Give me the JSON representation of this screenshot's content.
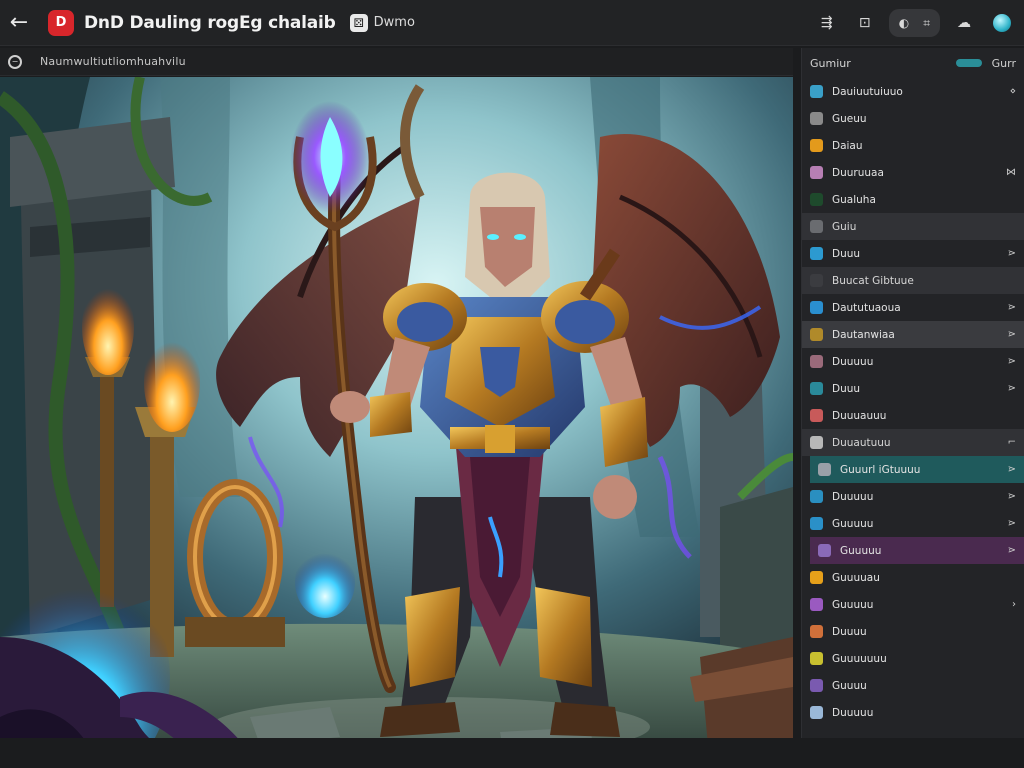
{
  "header": {
    "app_logo": "D",
    "title": "DnD Dauling rogEg chalaib",
    "doc_label": "Dwmo",
    "actions": {
      "share_icon": "share-icon",
      "camera_icon": "camera-icon",
      "pill_left": "◐",
      "pill_right": "⌗"
    }
  },
  "subbar": {
    "path": "Naumwultiutliomhuahvilu"
  },
  "panel": {
    "title": "Gumiur",
    "meta": "Gurr",
    "layers": [
      {
        "name": "Dauiuutuiuuo",
        "color": "#3aa0c8",
        "vis": "⋄",
        "style": ""
      },
      {
        "name": "Gueuu",
        "color": "#8a8a8a",
        "vis": "",
        "style": ""
      },
      {
        "name": "Daiau",
        "color": "#e39a1c",
        "vis": "",
        "style": ""
      },
      {
        "name": "Duuruuaa",
        "color": "#b77fb4",
        "vis": "⋈",
        "style": ""
      },
      {
        "name": "Gualuha",
        "color": "#1e4a2c",
        "vis": "",
        "style": ""
      },
      {
        "name": "Guiu",
        "color": "#6a6c70",
        "vis": "",
        "style": "group"
      },
      {
        "name": "Duuu",
        "color": "#2c9ad0",
        "vis": "⋗",
        "style": ""
      },
      {
        "name": "Buucat Gibtuue",
        "color": "#3b3c40",
        "vis": "",
        "style": "group"
      },
      {
        "name": "Daututuaoua",
        "color": "#2a8fd0",
        "vis": "⋗",
        "style": ""
      },
      {
        "name": "Dautanwiaa",
        "color": "#b08a2a",
        "vis": "⋗",
        "style": "sel-grey"
      },
      {
        "name": "Duuuuu",
        "color": "#9a6a7a",
        "vis": "⋗",
        "style": ""
      },
      {
        "name": "Duuu",
        "color": "#2a8a9a",
        "vis": "⋗",
        "style": ""
      },
      {
        "name": "Duuuauuu",
        "color": "#c85a5a",
        "vis": "",
        "style": ""
      },
      {
        "name": "Duuautuuu",
        "color": "#b8b8b8",
        "vis": "⌐",
        "style": "group"
      },
      {
        "name": "Guuurl iGtuuuu",
        "color": "#9aa0a8",
        "vis": "⋗",
        "style": "sel-teal"
      },
      {
        "name": "Duuuuu",
        "color": "#2a8fc0",
        "vis": "⋗",
        "style": ""
      },
      {
        "name": "Guuuuu",
        "color": "#2a90c8",
        "vis": "⋗",
        "style": ""
      },
      {
        "name": "Guuuuu",
        "color": "#8a6ab8",
        "vis": "⋗",
        "style": "sel-purple"
      },
      {
        "name": "Guuuuau",
        "color": "#e6a01a",
        "vis": "",
        "style": ""
      },
      {
        "name": "Guuuuu",
        "color": "#9a5ac0",
        "vis": "›",
        "style": ""
      },
      {
        "name": "Duuuu",
        "color": "#d0703a",
        "vis": "",
        "style": ""
      },
      {
        "name": "Guuuuuuu",
        "color": "#c8c030",
        "vis": "",
        "style": ""
      },
      {
        "name": "Guuuu",
        "color": "#7a5ab0",
        "vis": "",
        "style": ""
      },
      {
        "name": "Duuuuu",
        "color": "#9ab8d8",
        "vis": "",
        "style": ""
      }
    ]
  }
}
